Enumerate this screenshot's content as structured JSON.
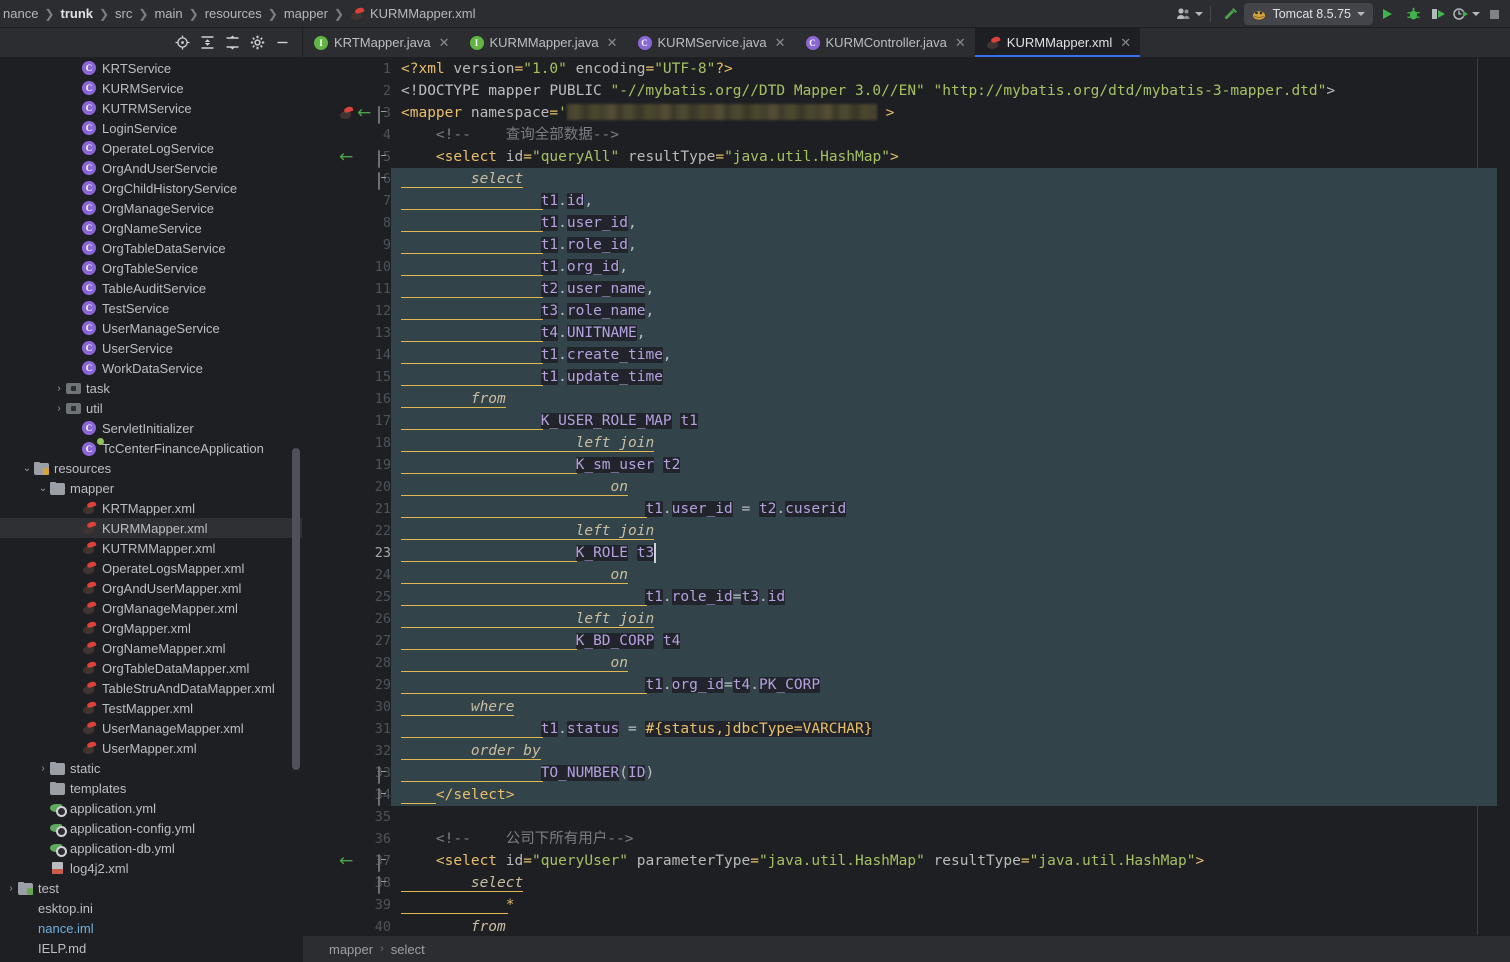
{
  "breadcrumb": {
    "items": [
      "nance",
      "trunk",
      "src",
      "main",
      "resources",
      "mapper"
    ],
    "file": "KURMMapper.xml",
    "file_icon": "mybatis-xml-icon"
  },
  "toolbar": {
    "account_icon": "user-account-icon",
    "build_icon": "build-hammer-icon",
    "run_config_name": "Tomcat 8.5.75",
    "run_config_icon": "tomcat-icon",
    "run_icon": "run-icon",
    "debug_icon": "debug-bug-icon",
    "run_coverage_icon": "run-with-coverage-icon",
    "profiler_icon": "profiler-icon",
    "stop_icon": "stop-icon"
  },
  "project_toolbar": {
    "locate_label": "select-opened-file-icon",
    "expand_label": "expand-all-icon",
    "collapse_label": "collapse-all-icon",
    "settings_label": "gear-icon",
    "hide_label": "hide-icon"
  },
  "tabs": [
    {
      "label": "KRTMapper.java",
      "icon": "interface-icon",
      "kind": "i",
      "active": false
    },
    {
      "label": "KURMMapper.java",
      "icon": "interface-icon",
      "kind": "i",
      "active": false
    },
    {
      "label": "KURMService.java",
      "icon": "class-icon",
      "kind": "c",
      "active": false
    },
    {
      "label": "KURMController.java",
      "icon": "class-icon",
      "kind": "c",
      "active": false
    },
    {
      "label": "KURMMapper.xml",
      "icon": "mybatis-xml-icon",
      "kind": "mb",
      "active": true
    }
  ],
  "sidebar": {
    "items": [
      {
        "label": "KRTService",
        "kind": "class",
        "indent": 4,
        "arrow": ""
      },
      {
        "label": "KURMService",
        "kind": "class",
        "indent": 4,
        "arrow": ""
      },
      {
        "label": "KUTRMService",
        "kind": "class",
        "indent": 4,
        "arrow": ""
      },
      {
        "label": "LoginService",
        "kind": "class",
        "indent": 4,
        "arrow": ""
      },
      {
        "label": "OperateLogService",
        "kind": "class",
        "indent": 4,
        "arrow": ""
      },
      {
        "label": "OrgAndUserServcie",
        "kind": "class",
        "indent": 4,
        "arrow": ""
      },
      {
        "label": "OrgChildHistoryService",
        "kind": "class",
        "indent": 4,
        "arrow": ""
      },
      {
        "label": "OrgManageService",
        "kind": "class",
        "indent": 4,
        "arrow": ""
      },
      {
        "label": "OrgNameService",
        "kind": "class",
        "indent": 4,
        "arrow": ""
      },
      {
        "label": "OrgTableDataService",
        "kind": "class",
        "indent": 4,
        "arrow": ""
      },
      {
        "label": "OrgTableService",
        "kind": "class",
        "indent": 4,
        "arrow": ""
      },
      {
        "label": "TableAuditService",
        "kind": "class",
        "indent": 4,
        "arrow": ""
      },
      {
        "label": "TestService",
        "kind": "class",
        "indent": 4,
        "arrow": ""
      },
      {
        "label": "UserManageService",
        "kind": "class",
        "indent": 4,
        "arrow": ""
      },
      {
        "label": "UserService",
        "kind": "class",
        "indent": 4,
        "arrow": ""
      },
      {
        "label": "WorkDataService",
        "kind": "class",
        "indent": 4,
        "arrow": ""
      },
      {
        "label": "task",
        "kind": "package",
        "indent": 3,
        "arrow": "›"
      },
      {
        "label": "util",
        "kind": "package",
        "indent": 3,
        "arrow": "›"
      },
      {
        "label": "ServletInitializer",
        "kind": "class",
        "indent": 4,
        "arrow": ""
      },
      {
        "label": "TcCenterFinanceApplication",
        "kind": "spring",
        "indent": 4,
        "arrow": ""
      },
      {
        "label": "resources",
        "kind": "res-folder",
        "indent": 1,
        "arrow": "⌄"
      },
      {
        "label": "mapper",
        "kind": "folder",
        "indent": 2,
        "arrow": "⌄"
      },
      {
        "label": "KRTMapper.xml",
        "kind": "mybatis",
        "indent": 4,
        "arrow": ""
      },
      {
        "label": "KURMMapper.xml",
        "kind": "mybatis",
        "indent": 4,
        "arrow": "",
        "selected": true
      },
      {
        "label": "KUTRMMapper.xml",
        "kind": "mybatis",
        "indent": 4,
        "arrow": ""
      },
      {
        "label": "OperateLogsMapper.xml",
        "kind": "mybatis",
        "indent": 4,
        "arrow": ""
      },
      {
        "label": "OrgAndUserMapper.xml",
        "kind": "mybatis",
        "indent": 4,
        "arrow": ""
      },
      {
        "label": "OrgManageMapper.xml",
        "kind": "mybatis",
        "indent": 4,
        "arrow": ""
      },
      {
        "label": "OrgMapper.xml",
        "kind": "mybatis",
        "indent": 4,
        "arrow": ""
      },
      {
        "label": "OrgNameMapper.xml",
        "kind": "mybatis",
        "indent": 4,
        "arrow": ""
      },
      {
        "label": "OrgTableDataMapper.xml",
        "kind": "mybatis",
        "indent": 4,
        "arrow": ""
      },
      {
        "label": "TableStruAndDataMapper.xml",
        "kind": "mybatis",
        "indent": 4,
        "arrow": ""
      },
      {
        "label": "TestMapper.xml",
        "kind": "mybatis",
        "indent": 4,
        "arrow": ""
      },
      {
        "label": "UserManageMapper.xml",
        "kind": "mybatis",
        "indent": 4,
        "arrow": ""
      },
      {
        "label": "UserMapper.xml",
        "kind": "mybatis",
        "indent": 4,
        "arrow": ""
      },
      {
        "label": "static",
        "kind": "folder",
        "indent": 2,
        "arrow": "›"
      },
      {
        "label": "templates",
        "kind": "folder",
        "indent": 2,
        "arrow": ""
      },
      {
        "label": "application.yml",
        "kind": "yaml",
        "indent": 2,
        "arrow": ""
      },
      {
        "label": "application-config.yml",
        "kind": "yaml",
        "indent": 2,
        "arrow": ""
      },
      {
        "label": "application-db.yml",
        "kind": "yaml",
        "indent": 2,
        "arrow": ""
      },
      {
        "label": "log4j2.xml",
        "kind": "xml",
        "indent": 2,
        "arrow": ""
      },
      {
        "label": "test",
        "kind": "test-folder",
        "indent": 0,
        "arrow": "›"
      },
      {
        "label": "esktop.ini",
        "kind": "plain",
        "indent": 0,
        "arrow": ""
      },
      {
        "label": "nance.iml",
        "kind": "iml",
        "indent": 0,
        "arrow": ""
      },
      {
        "label": "IELP.md",
        "kind": "plain",
        "indent": 0,
        "arrow": ""
      }
    ]
  },
  "editor": {
    "current_line": 23,
    "selection_start_line": 6,
    "selection_end_line": 34,
    "namespace_redacted": true,
    "lines": [
      {
        "n": 1,
        "text": "<?xml version=\"1.0\" encoding=\"UTF-8\"?>"
      },
      {
        "n": 2,
        "text": "<!DOCTYPE mapper PUBLIC \"-//mybatis.org//DTD Mapper 3.0//EN\" \"http://mybatis.org/dtd/mybatis-3-mapper.dtd\">"
      },
      {
        "n": 3,
        "text": "<mapper namespace='████████████' >"
      },
      {
        "n": 4,
        "text": "    <!--    查询全部数据-->"
      },
      {
        "n": 5,
        "text": "    <select id=\"queryAll\" resultType=\"java.util.HashMap\">"
      },
      {
        "n": 6,
        "text": "        select"
      },
      {
        "n": 7,
        "text": "                t1.id,"
      },
      {
        "n": 8,
        "text": "                t1.user_id,"
      },
      {
        "n": 9,
        "text": "                t1.role_id,"
      },
      {
        "n": 10,
        "text": "                t1.org_id,"
      },
      {
        "n": 11,
        "text": "                t2.user_name,"
      },
      {
        "n": 12,
        "text": "                t3.role_name,"
      },
      {
        "n": 13,
        "text": "                t4.UNITNAME,"
      },
      {
        "n": 14,
        "text": "                t1.create_time,"
      },
      {
        "n": 15,
        "text": "                t1.update_time"
      },
      {
        "n": 16,
        "text": "        from"
      },
      {
        "n": 17,
        "text": "                K_USER_ROLE_MAP t1"
      },
      {
        "n": 18,
        "text": "                    left join"
      },
      {
        "n": 19,
        "text": "                    K_sm_user t2"
      },
      {
        "n": 20,
        "text": "                        on"
      },
      {
        "n": 21,
        "text": "                            t1.user_id = t2.cuserid"
      },
      {
        "n": 22,
        "text": "                    left join"
      },
      {
        "n": 23,
        "text": "                    K_ROLE t3"
      },
      {
        "n": 24,
        "text": "                        on"
      },
      {
        "n": 25,
        "text": "                            t1.role_id=t3.id"
      },
      {
        "n": 26,
        "text": "                    left join"
      },
      {
        "n": 27,
        "text": "                    K_BD_CORP t4"
      },
      {
        "n": 28,
        "text": "                        on"
      },
      {
        "n": 29,
        "text": "                            t1.org_id=t4.PK_CORP"
      },
      {
        "n": 30,
        "text": "        where"
      },
      {
        "n": 31,
        "text": "                t1.status = #{status,jdbcType=VARCHAR}"
      },
      {
        "n": 32,
        "text": "        order by"
      },
      {
        "n": 33,
        "text": "                TO_NUMBER(ID)"
      },
      {
        "n": 34,
        "text": "    </select>"
      },
      {
        "n": 35,
        "text": ""
      },
      {
        "n": 36,
        "text": "    <!--    公司下所有用户-->"
      },
      {
        "n": 37,
        "text": "    <select id=\"queryUser\" parameterType=\"java.util.HashMap\" resultType=\"java.util.HashMap\">"
      },
      {
        "n": 38,
        "text": "        select"
      },
      {
        "n": 39,
        "text": "            *"
      },
      {
        "n": 40,
        "text": "        from"
      }
    ]
  },
  "status_breadcrumb": {
    "left": "mapper",
    "sep": "›",
    "right": "select"
  }
}
